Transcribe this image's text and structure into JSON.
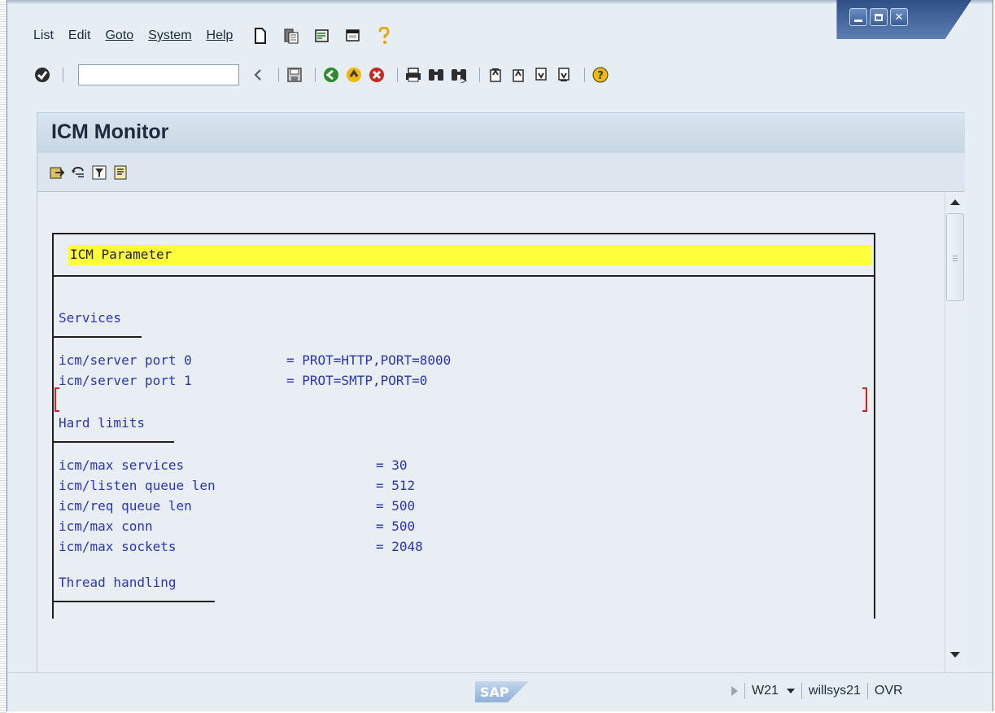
{
  "menubar": {
    "items": [
      "List",
      "Edit",
      "Goto",
      "System",
      "Help"
    ],
    "icons": [
      "new-session-icon",
      "clipboard-icon",
      "script-icon",
      "layout-icon",
      "help-question-icon"
    ]
  },
  "toolbar": {
    "command_value": "",
    "icons": [
      "enter-check-icon",
      "back-arrow-icon",
      "save-icon",
      "back-green-icon",
      "exit-yellow-icon",
      "cancel-red-icon",
      "print-icon",
      "find-icon",
      "find-next-icon",
      "first-page-icon",
      "prev-page-icon",
      "next-page-icon",
      "last-page-icon",
      "help-icon"
    ]
  },
  "title": "ICM Monitor",
  "app_toolbar": {
    "icons": [
      "export-icon",
      "refresh-icon",
      "filter-icon",
      "details-icon"
    ]
  },
  "list": {
    "header": "ICM Parameter",
    "sections": [
      {
        "title": "Services",
        "rows": [
          {
            "key": "icm/server port 0",
            "value": "= PROT=HTTP,PORT=8000"
          },
          {
            "key": "icm/server port 1",
            "value": "= PROT=SMTP,PORT=0"
          }
        ]
      },
      {
        "title": "Hard limits",
        "rows": [
          {
            "key": "icm/max services",
            "value": "= 30"
          },
          {
            "key": "icm/listen queue len",
            "value": "= 512"
          },
          {
            "key": "icm/req queue len",
            "value": "= 500"
          },
          {
            "key": "icm/max conn",
            "value": "= 500"
          },
          {
            "key": "icm/max sockets",
            "value": "= 2048"
          }
        ]
      },
      {
        "title": "Thread handling",
        "rows": []
      }
    ]
  },
  "statusbar": {
    "logo": "SAP",
    "system": "W21",
    "server": "willsys21",
    "mode": "OVR"
  },
  "colors": {
    "highlight": "#ffff3c",
    "list_text": "#2a35b8",
    "window_bg": "#e6edf3"
  }
}
